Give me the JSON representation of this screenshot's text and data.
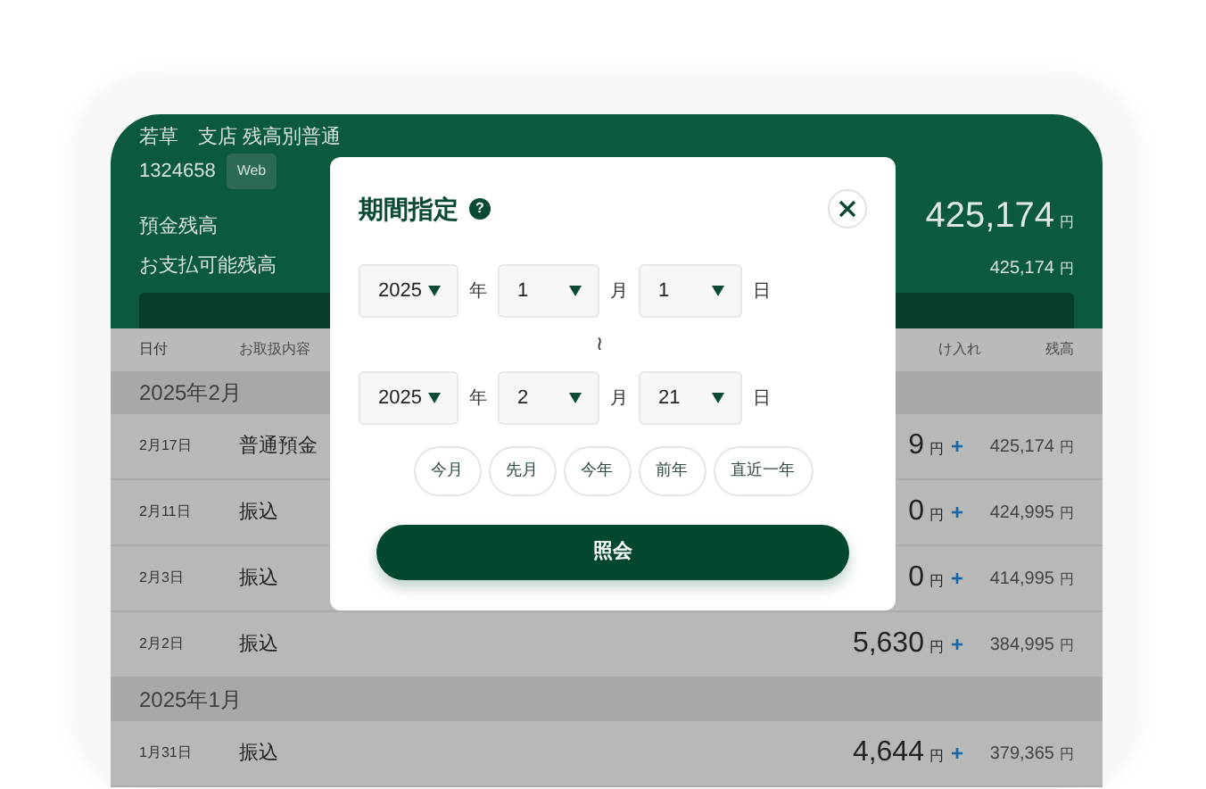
{
  "account": {
    "branch_line": "若草　支店 残高別普通",
    "number": "1324658",
    "badge": "Web"
  },
  "balances": [
    {
      "kind": "main",
      "label": "預金残高",
      "amount": "425,174",
      "unit": "円"
    },
    {
      "kind": "sub",
      "label": "お支払可能残高",
      "amount": "425,174",
      "unit": "円"
    }
  ],
  "table": {
    "columns": [
      {
        "label": "日付"
      },
      {
        "label": "お取扱内容"
      },
      {
        "label": "け入れ"
      },
      {
        "label": "残高"
      }
    ],
    "groups": [
      {
        "month": "2025年2月",
        "rows": [
          {
            "date": "2月17日",
            "description": "普通預金",
            "amount": "9",
            "unit": "円",
            "sign": "+",
            "balance": "425,174",
            "balance_unit": "円"
          },
          {
            "date": "2月11日",
            "description": "振込",
            "amount": "0",
            "unit": "円",
            "sign": "+",
            "balance": "424,995",
            "balance_unit": "円"
          },
          {
            "date": "2月3日",
            "description": "振込",
            "amount": "0",
            "unit": "円",
            "sign": "+",
            "balance": "414,995",
            "balance_unit": "円"
          },
          {
            "date": "2月2日",
            "description": "振込",
            "amount": "5,630",
            "unit": "円",
            "sign": "+",
            "balance": "384,995",
            "balance_unit": "円"
          }
        ]
      },
      {
        "month": "2025年1月",
        "rows": [
          {
            "date": "1月31日",
            "description": "振込",
            "amount": "4,644",
            "unit": "円",
            "sign": "+",
            "balance": "379,365",
            "balance_unit": "円"
          }
        ]
      }
    ]
  },
  "modal": {
    "title": "期間指定",
    "help_icon": "?",
    "from": {
      "year": "2025",
      "year_unit": "年",
      "month": "1",
      "month_unit": "月",
      "day": "1",
      "day_unit": "日"
    },
    "separator": "≀",
    "to": {
      "year": "2025",
      "year_unit": "年",
      "month": "2",
      "month_unit": "月",
      "day": "21",
      "day_unit": "日"
    },
    "presets": [
      "今月",
      "先月",
      "今年",
      "前年",
      "直近一年"
    ],
    "submit": "照会"
  }
}
